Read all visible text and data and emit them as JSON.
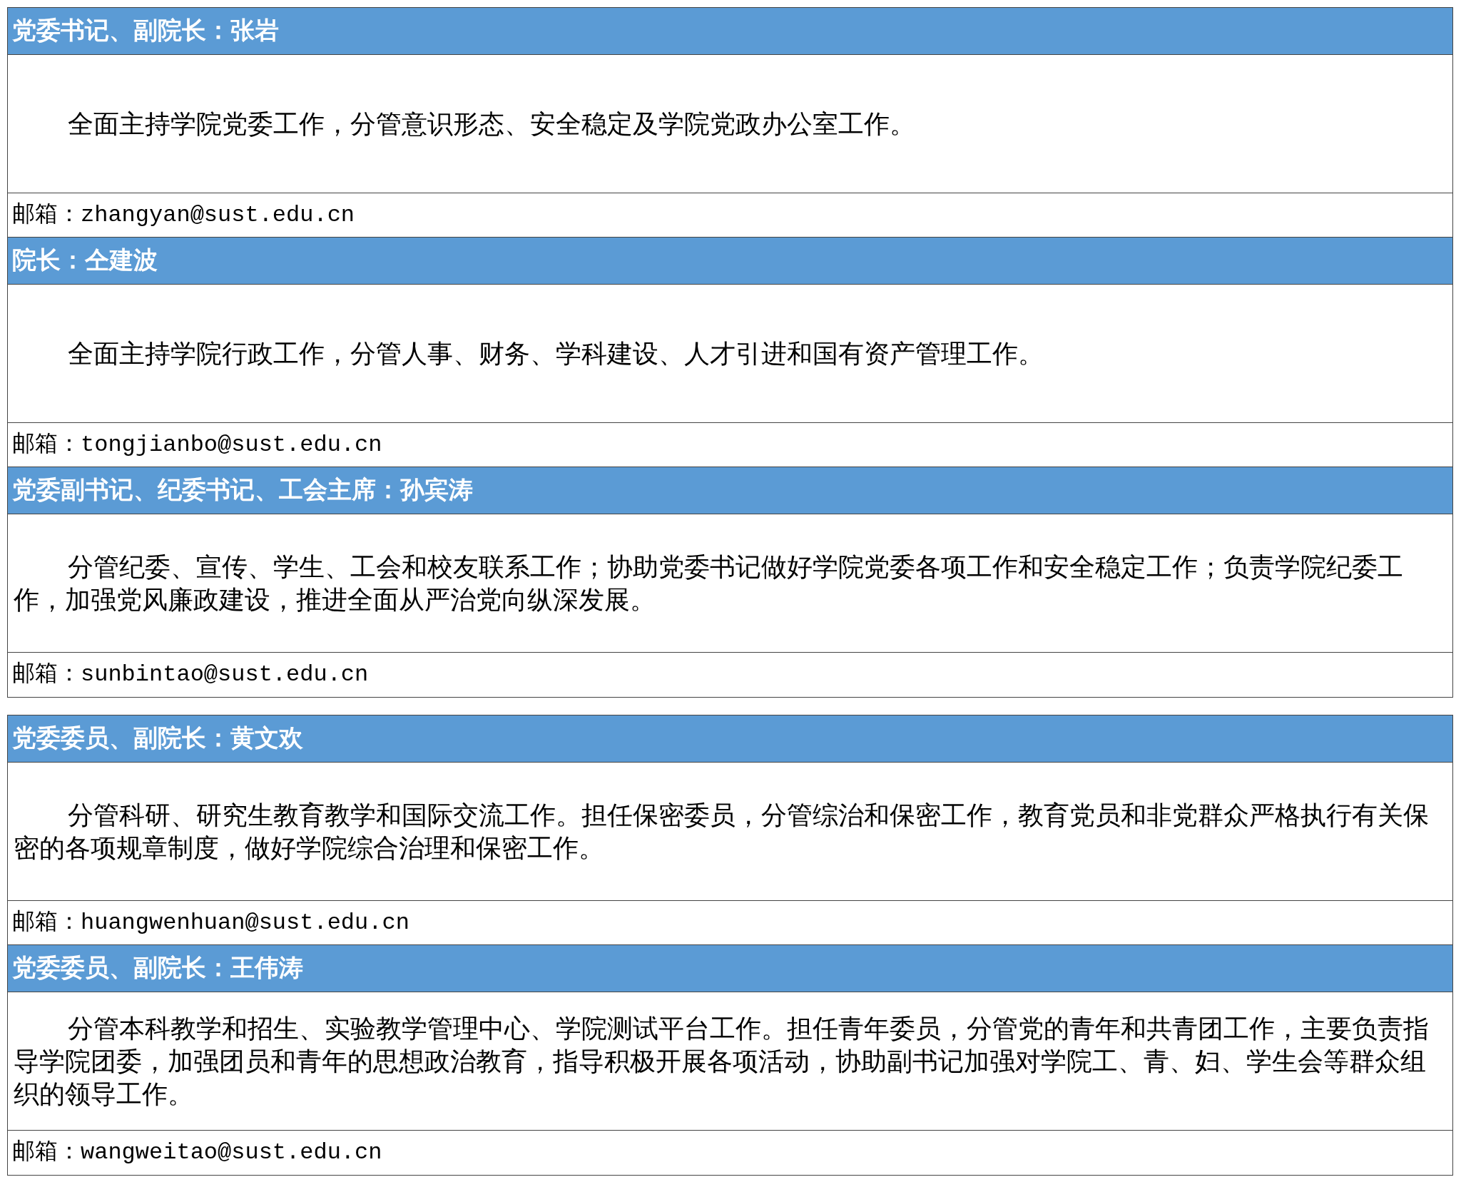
{
  "sections": [
    {
      "entries": [
        {
          "title": "党委书记、副院长：张岩",
          "duty": "全面主持学院党委工作，分管意识形态、安全稳定及学院党政办公室工作。",
          "email": "邮箱：zhangyan@sust.edu.cn"
        },
        {
          "title": "院长：仝建波",
          "duty": "全面主持学院行政工作，分管人事、财务、学科建设、人才引进和国有资产管理工作。",
          "email": "邮箱：tongjianbo@sust.edu.cn"
        },
        {
          "title": "党委副书记、纪委书记、工会主席：孙宾涛",
          "duty": "分管纪委、宣传、学生、工会和校友联系工作；协助党委书记做好学院党委各项工作和安全稳定工作；负责学院纪委工作，加强党风廉政建设，推进全面从严治党向纵深发展。",
          "email": "邮箱：sunbintao@sust.edu.cn"
        }
      ]
    },
    {
      "entries": [
        {
          "title": "党委委员、副院长：黄文欢",
          "duty": "分管科研、研究生教育教学和国际交流工作。担任保密委员，分管综治和保密工作，教育党员和非党群众严格执行有关保密的各项规章制度，做好学院综合治理和保密工作。",
          "email": "邮箱：huangwenhuan@sust.edu.cn"
        },
        {
          "title": "党委委员、副院长：王伟涛",
          "duty": "分管本科教学和招生、实验教学管理中心、学院测试平台工作。担任青年委员，分管党的青年和共青团工作，主要负责指导学院团委，加强团员和青年的思想政治教育，指导积极开展各项活动，协助副书记加强对学院工、青、妇、学生会等群众组织的领导工作。",
          "email": "邮箱：wangweitao@sust.edu.cn"
        }
      ]
    }
  ]
}
